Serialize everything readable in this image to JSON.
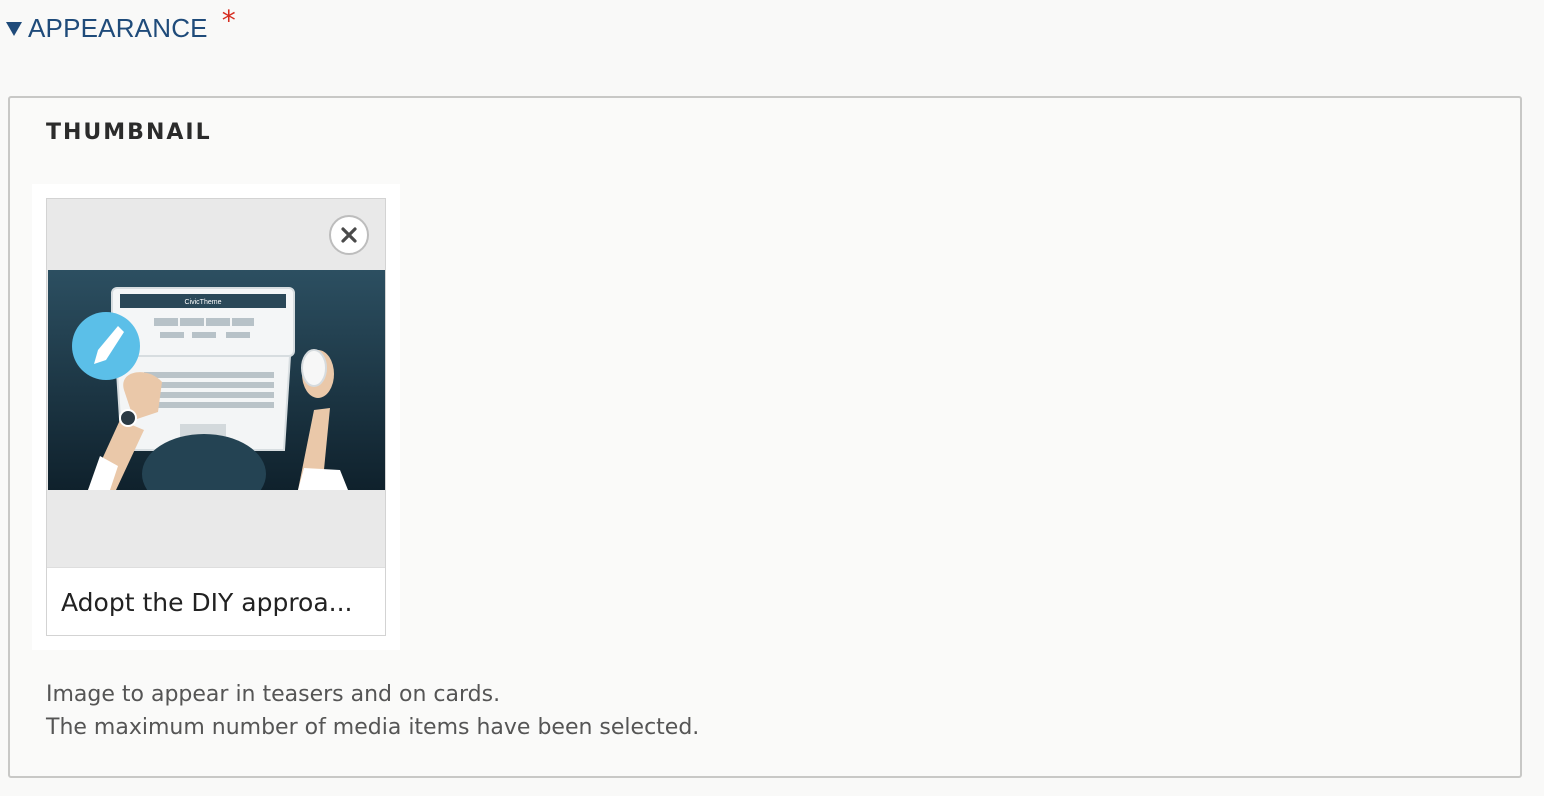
{
  "section": {
    "title": "APPEARANCE",
    "required_marker": "*",
    "collapse_icon": "triangle-down-icon"
  },
  "field": {
    "legend": "THUMBNAIL",
    "media_item": {
      "caption": "Adopt the DIY approa...",
      "remove_icon": "close-circle-icon",
      "thumbnail_brand_text": "CivicTheme"
    },
    "description": "Image to appear in teasers and on cards.",
    "status_message": "The maximum number of media items have been selected."
  },
  "colors": {
    "section_title": "#1f4b7a",
    "required": "#d62d20",
    "thumbnail_bg_top": "#2b4d5f",
    "thumbnail_bg_bottom": "#10202b",
    "paint_badge": "#5bbfe8"
  }
}
